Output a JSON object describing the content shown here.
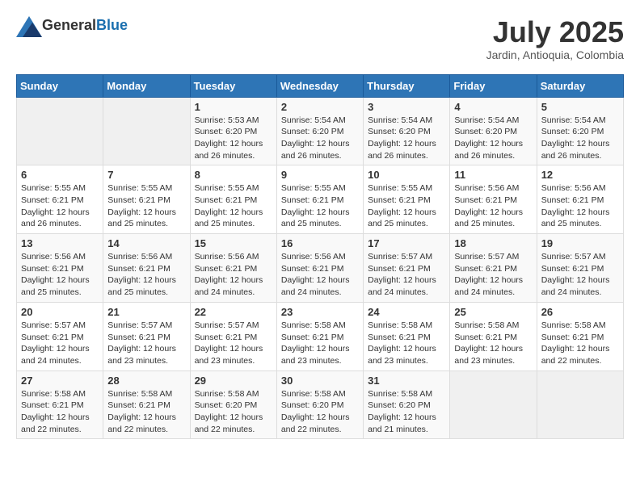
{
  "header": {
    "logo_general": "General",
    "logo_blue": "Blue",
    "month": "July 2025",
    "location": "Jardin, Antioquia, Colombia"
  },
  "weekdays": [
    "Sunday",
    "Monday",
    "Tuesday",
    "Wednesday",
    "Thursday",
    "Friday",
    "Saturday"
  ],
  "weeks": [
    [
      {
        "day": "",
        "empty": true
      },
      {
        "day": "",
        "empty": true
      },
      {
        "day": "1",
        "sunrise": "5:53 AM",
        "sunset": "6:20 PM",
        "daylight": "12 hours and 26 minutes."
      },
      {
        "day": "2",
        "sunrise": "5:54 AM",
        "sunset": "6:20 PM",
        "daylight": "12 hours and 26 minutes."
      },
      {
        "day": "3",
        "sunrise": "5:54 AM",
        "sunset": "6:20 PM",
        "daylight": "12 hours and 26 minutes."
      },
      {
        "day": "4",
        "sunrise": "5:54 AM",
        "sunset": "6:20 PM",
        "daylight": "12 hours and 26 minutes."
      },
      {
        "day": "5",
        "sunrise": "5:54 AM",
        "sunset": "6:20 PM",
        "daylight": "12 hours and 26 minutes."
      }
    ],
    [
      {
        "day": "6",
        "sunrise": "5:55 AM",
        "sunset": "6:21 PM",
        "daylight": "12 hours and 26 minutes."
      },
      {
        "day": "7",
        "sunrise": "5:55 AM",
        "sunset": "6:21 PM",
        "daylight": "12 hours and 25 minutes."
      },
      {
        "day": "8",
        "sunrise": "5:55 AM",
        "sunset": "6:21 PM",
        "daylight": "12 hours and 25 minutes."
      },
      {
        "day": "9",
        "sunrise": "5:55 AM",
        "sunset": "6:21 PM",
        "daylight": "12 hours and 25 minutes."
      },
      {
        "day": "10",
        "sunrise": "5:55 AM",
        "sunset": "6:21 PM",
        "daylight": "12 hours and 25 minutes."
      },
      {
        "day": "11",
        "sunrise": "5:56 AM",
        "sunset": "6:21 PM",
        "daylight": "12 hours and 25 minutes."
      },
      {
        "day": "12",
        "sunrise": "5:56 AM",
        "sunset": "6:21 PM",
        "daylight": "12 hours and 25 minutes."
      }
    ],
    [
      {
        "day": "13",
        "sunrise": "5:56 AM",
        "sunset": "6:21 PM",
        "daylight": "12 hours and 25 minutes."
      },
      {
        "day": "14",
        "sunrise": "5:56 AM",
        "sunset": "6:21 PM",
        "daylight": "12 hours and 25 minutes."
      },
      {
        "day": "15",
        "sunrise": "5:56 AM",
        "sunset": "6:21 PM",
        "daylight": "12 hours and 24 minutes."
      },
      {
        "day": "16",
        "sunrise": "5:56 AM",
        "sunset": "6:21 PM",
        "daylight": "12 hours and 24 minutes."
      },
      {
        "day": "17",
        "sunrise": "5:57 AM",
        "sunset": "6:21 PM",
        "daylight": "12 hours and 24 minutes."
      },
      {
        "day": "18",
        "sunrise": "5:57 AM",
        "sunset": "6:21 PM",
        "daylight": "12 hours and 24 minutes."
      },
      {
        "day": "19",
        "sunrise": "5:57 AM",
        "sunset": "6:21 PM",
        "daylight": "12 hours and 24 minutes."
      }
    ],
    [
      {
        "day": "20",
        "sunrise": "5:57 AM",
        "sunset": "6:21 PM",
        "daylight": "12 hours and 24 minutes."
      },
      {
        "day": "21",
        "sunrise": "5:57 AM",
        "sunset": "6:21 PM",
        "daylight": "12 hours and 23 minutes."
      },
      {
        "day": "22",
        "sunrise": "5:57 AM",
        "sunset": "6:21 PM",
        "daylight": "12 hours and 23 minutes."
      },
      {
        "day": "23",
        "sunrise": "5:58 AM",
        "sunset": "6:21 PM",
        "daylight": "12 hours and 23 minutes."
      },
      {
        "day": "24",
        "sunrise": "5:58 AM",
        "sunset": "6:21 PM",
        "daylight": "12 hours and 23 minutes."
      },
      {
        "day": "25",
        "sunrise": "5:58 AM",
        "sunset": "6:21 PM",
        "daylight": "12 hours and 23 minutes."
      },
      {
        "day": "26",
        "sunrise": "5:58 AM",
        "sunset": "6:21 PM",
        "daylight": "12 hours and 22 minutes."
      }
    ],
    [
      {
        "day": "27",
        "sunrise": "5:58 AM",
        "sunset": "6:21 PM",
        "daylight": "12 hours and 22 minutes."
      },
      {
        "day": "28",
        "sunrise": "5:58 AM",
        "sunset": "6:21 PM",
        "daylight": "12 hours and 22 minutes."
      },
      {
        "day": "29",
        "sunrise": "5:58 AM",
        "sunset": "6:20 PM",
        "daylight": "12 hours and 22 minutes."
      },
      {
        "day": "30",
        "sunrise": "5:58 AM",
        "sunset": "6:20 PM",
        "daylight": "12 hours and 22 minutes."
      },
      {
        "day": "31",
        "sunrise": "5:58 AM",
        "sunset": "6:20 PM",
        "daylight": "12 hours and 21 minutes."
      },
      {
        "day": "",
        "empty": true
      },
      {
        "day": "",
        "empty": true
      }
    ]
  ],
  "labels": {
    "sunrise_prefix": "Sunrise: ",
    "sunset_prefix": "Sunset: ",
    "daylight_prefix": "Daylight: "
  }
}
